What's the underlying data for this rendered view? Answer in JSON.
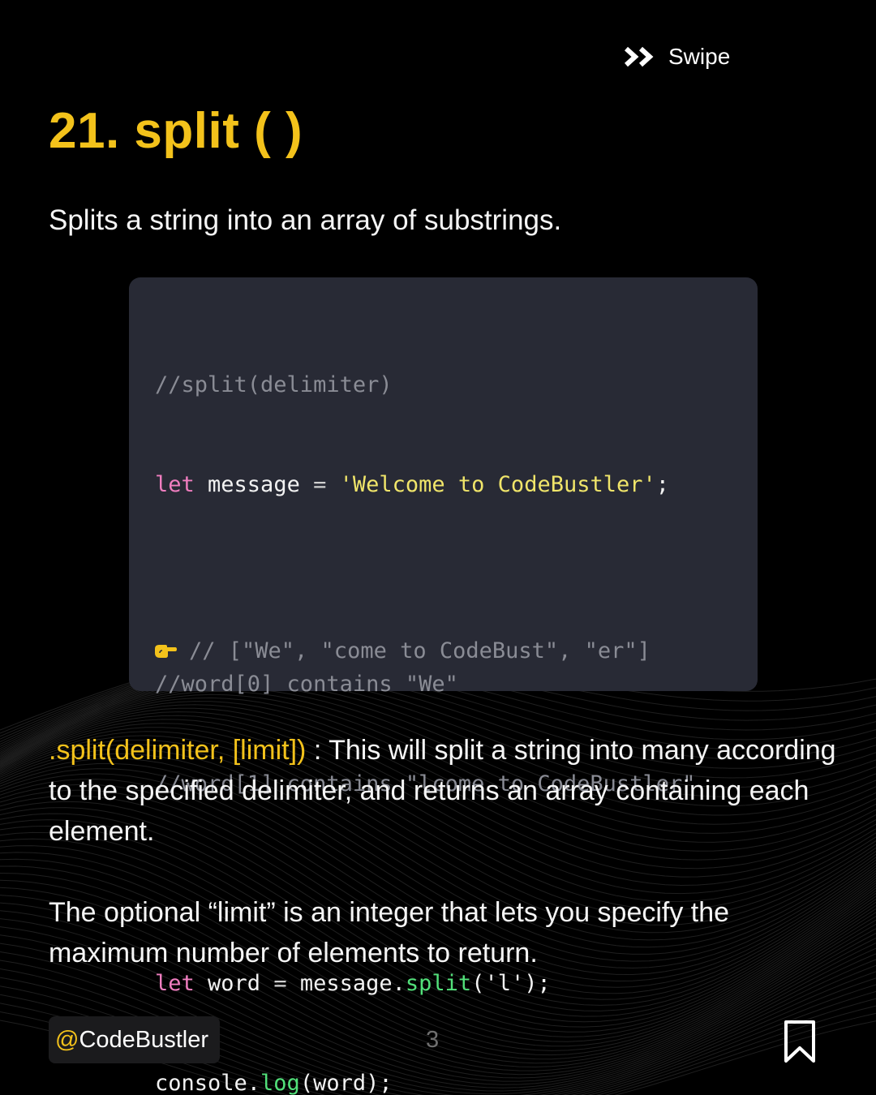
{
  "swipe": {
    "label": "Swipe",
    "icon": "double-chevron-right-icon"
  },
  "title": "21. split ( )",
  "subtitle": "Splits a string into an array of substrings.",
  "code": {
    "line1": "//split(delimiter)",
    "line2": {
      "kw": "let",
      "var": " message ",
      "op": "=",
      "str": " 'Welcome to CodeBustler'",
      "end": ";"
    },
    "line3": "//word[0] contains \"We\"",
    "line4": "//word[1] contains \"lcome to CodeBustler\"",
    "line5": {
      "kw": "let",
      "var": " word ",
      "op": "=",
      "obj": " message.",
      "fn": "split",
      "args": "('l');"
    },
    "line6": {
      "obj": "console.",
      "fn": "log",
      "args": "(word);"
    },
    "output_icon": "pointing-hand-icon",
    "output": "// [\"We\", \"come to CodeBust\", \"er\"]"
  },
  "description1": {
    "highlight": ".split(delimiter, [limit])",
    "text": " : This will split a string into many according to the specified delimiter, and returns an array containing each element."
  },
  "description2": "The optional “limit” is an integer that lets you specify the maximum number of elements to return.",
  "footer": {
    "handle_at": "@",
    "handle_name": "CodeBustler",
    "page": "3",
    "bookmark_icon": "bookmark-icon"
  },
  "colors": {
    "accent": "#f3c21b",
    "code_bg": "#282a35",
    "keyword": "#f07ec0",
    "string": "#f0e56a",
    "function": "#52e07a",
    "comment": "#8a8c95"
  }
}
